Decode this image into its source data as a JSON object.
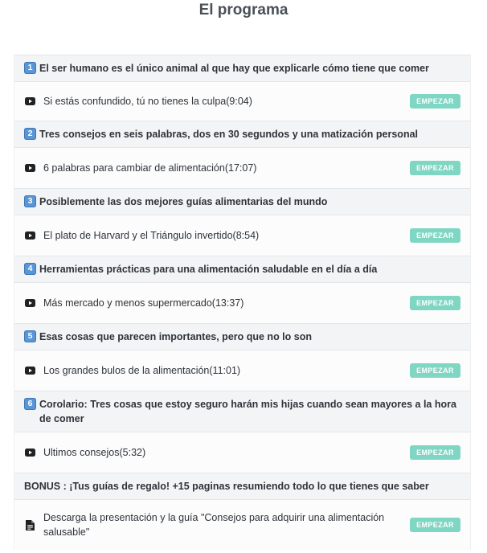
{
  "page": {
    "title": "El programa"
  },
  "colors": {
    "start_button": "#7fd6c2",
    "badge": "#5a95d6",
    "header_bg": "#f3f4f6"
  },
  "sections": [
    {
      "badge": "1",
      "title": "El ser humano es el único animal al que hay que explicarle cómo tiene que comer",
      "lesson": {
        "icon": "video-icon",
        "label": "Si estás confundido, tú no tienes la culpa(9:04)",
        "button": "EMPEZAR"
      }
    },
    {
      "badge": "2",
      "title": "Tres consejos en seis palabras, dos en 30 segundos y una matización personal",
      "lesson": {
        "icon": "video-icon",
        "label": "6 palabras para cambiar de alimentación(17:07)",
        "button": "EMPEZAR"
      }
    },
    {
      "badge": "3",
      "title": "Posiblemente las dos mejores guías alimentarias del mundo",
      "lesson": {
        "icon": "video-icon",
        "label": "El plato de Harvard y el Triángulo invertido(8:54)",
        "button": "EMPEZAR"
      }
    },
    {
      "badge": "4",
      "title": "Herramientas prácticas para una alimentación saludable en el día a día",
      "lesson": {
        "icon": "video-icon",
        "label": "Más mercado y menos supermercado(13:37)",
        "button": "EMPEZAR"
      }
    },
    {
      "badge": "5",
      "title": "Esas cosas que parecen importantes, pero que no lo son",
      "lesson": {
        "icon": "video-icon",
        "label": "Los grandes bulos de la alimentación(11:01)",
        "button": "EMPEZAR"
      }
    },
    {
      "badge": "6",
      "title": "Corolario: Tres cosas que estoy seguro harán mis hijas cuando sean mayores a la hora de comer",
      "lesson": {
        "icon": "video-icon",
        "label": "Ultimos consejos(5:32)",
        "button": "EMPEZAR"
      }
    },
    {
      "badge": "",
      "title": "BONUS : ¡Tus guías de regalo! +15 paginas resumiendo todo lo que tienes que saber",
      "lesson": {
        "icon": "document-icon",
        "label": "Descarga la presentación y la guía \"Consejos para adquirir una alimentación salusable\"",
        "button": "EMPEZAR"
      }
    }
  ]
}
